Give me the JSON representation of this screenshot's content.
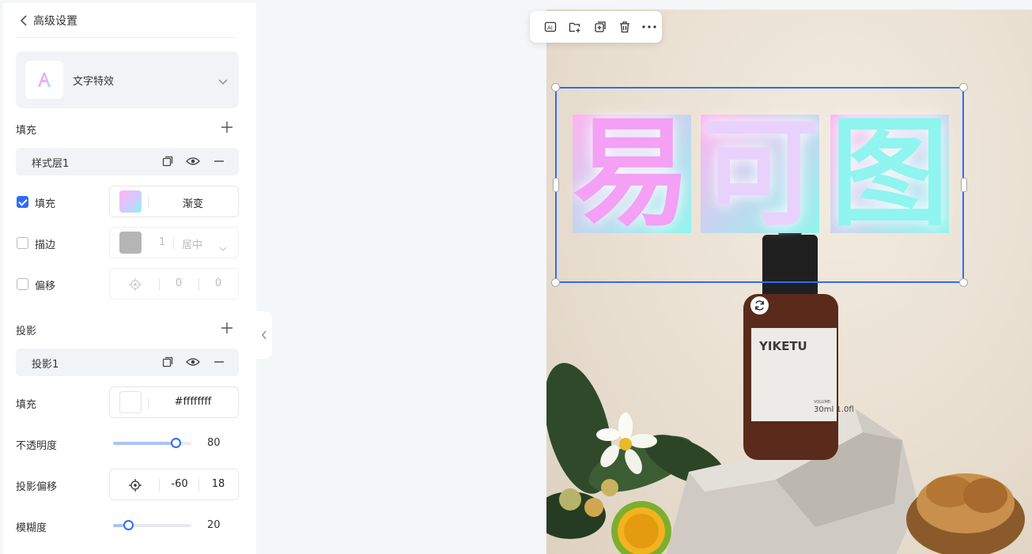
{
  "panel": {
    "header": {
      "title": "高级设置"
    },
    "effect": {
      "name": "文字特效"
    },
    "fill_section": {
      "title": "填充",
      "layer_label": "样式层1",
      "fill": {
        "label": "填充",
        "value": "渐变",
        "checked": true
      },
      "stroke": {
        "label": "描边",
        "width": "1",
        "align": "居中",
        "checked": false
      },
      "offset": {
        "label": "偏移",
        "x": "0",
        "y": "0",
        "checked": false
      }
    },
    "shadow_section": {
      "title": "投影",
      "layer_label": "投影1",
      "fill": {
        "label": "填充",
        "value": "#ffffffff"
      },
      "opacity": {
        "label": "不透明度",
        "value": 80
      },
      "offset": {
        "label": "投影偏移",
        "x": "-60",
        "y": "18"
      },
      "blur": {
        "label": "模糊度",
        "value": 20
      }
    }
  },
  "canvas": {
    "text_chars": [
      "易",
      "可",
      "图"
    ],
    "product_label": "YIKETU",
    "volume_small": "VOLUME:",
    "volume_text": "30ml 1.0fl"
  },
  "colors": {
    "accent": "#2f6cf6",
    "gradient_from": "#ffb3f0",
    "gradient_to": "#8ff5ee",
    "stroke_swatch": "#b5b5b5"
  }
}
